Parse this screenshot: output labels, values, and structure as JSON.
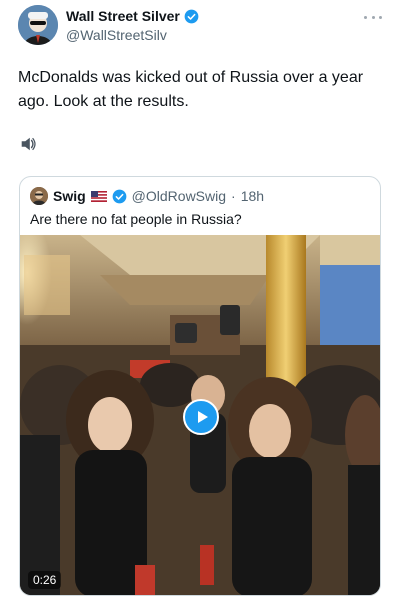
{
  "author": {
    "name": "Wall Street Silver",
    "handle": "@WallStreetSilv"
  },
  "tweet": {
    "text": "McDonalds was kicked out of Russia over a year ago. Look at the results.",
    "emoji": "speaker-icon"
  },
  "quoted": {
    "name": "Swig",
    "flag": "us-flag-icon",
    "handle": "@OldRowSwig",
    "separator": "·",
    "time": "18h",
    "text": "Are there no fat people in Russia?",
    "video": {
      "duration": "0:26"
    }
  },
  "colors": {
    "accent": "#1d9bf0",
    "text": "#0f1419",
    "secondary": "#536471",
    "border": "#cfd9de"
  }
}
